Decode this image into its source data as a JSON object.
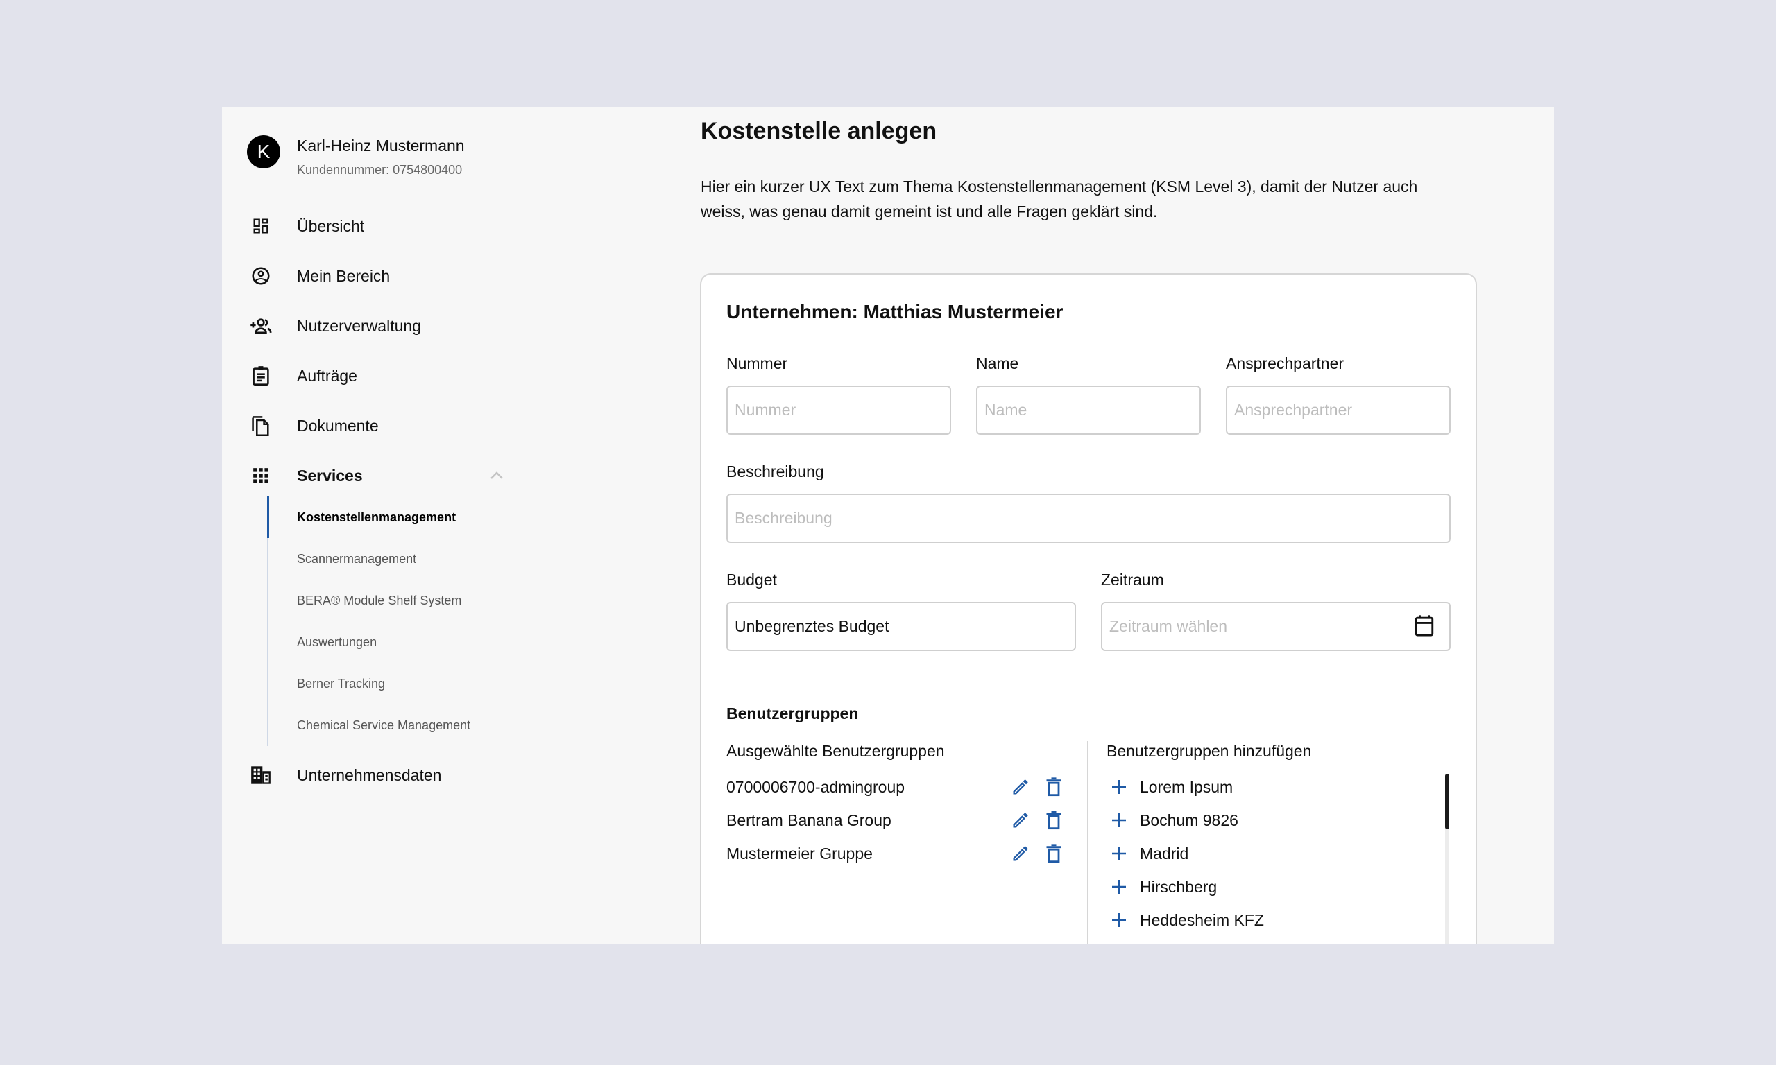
{
  "user": {
    "avatar_initial": "K",
    "name": "Karl-Heinz Mustermann",
    "customer_number": "Kundennummer: 0754800400"
  },
  "sidebar": {
    "items": [
      {
        "label": "Übersicht",
        "icon": "dashboard-icon"
      },
      {
        "label": "Mein Bereich",
        "icon": "account-circle-icon"
      },
      {
        "label": "Nutzerverwaltung",
        "icon": "group-add-icon"
      },
      {
        "label": "Aufträge",
        "icon": "clipboard-icon"
      },
      {
        "label": "Dokumente",
        "icon": "copy-documents-icon"
      },
      {
        "label": "Services",
        "icon": "apps-grid-icon",
        "expanded": true
      }
    ],
    "services_sub": [
      {
        "label": "Kostenstellenmanagement",
        "active": true
      },
      {
        "label": "Scannermanagement"
      },
      {
        "label": "BERA® Module Shelf System"
      },
      {
        "label": "Auswertungen"
      },
      {
        "label": "Berner Tracking"
      },
      {
        "label": "Chemical Service Management"
      }
    ],
    "bottom_item": {
      "label": "Unternehmensdaten",
      "icon": "business-building-icon"
    }
  },
  "main": {
    "title": "Kostenstelle anlegen",
    "description": "Hier ein kurzer UX Text zum Thema Kostenstellenmanagement (KSM Level 3), damit der Nutzer auch weiss, was genau damit gemeint ist und alle Fragen geklärt sind.",
    "card": {
      "title": "Unternehmen: Matthias Mustermeier",
      "fields": {
        "nummer": {
          "label": "Nummer",
          "placeholder": "Nummer",
          "value": ""
        },
        "name": {
          "label": "Name",
          "placeholder": "Name",
          "value": ""
        },
        "ansprechpartner": {
          "label": "Ansprechpartner",
          "placeholder": "Ansprechpartner",
          "value": ""
        },
        "beschreibung": {
          "label": "Beschreibung",
          "placeholder": "Beschreibung",
          "value": ""
        },
        "budget": {
          "label": "Budget",
          "value": "Unbegrenztes Budget"
        },
        "zeitraum": {
          "label": "Zeitraum",
          "placeholder": "Zeitraum wählen",
          "value": ""
        }
      },
      "groups": {
        "title": "Benutzergruppen",
        "selected_title": "Ausgewählte Benutzergruppen",
        "selected": [
          "0700006700-admingroup",
          "Bertram Banana Group",
          "Mustermeier Gruppe"
        ],
        "add_title": "Benutzergruppen hinzufügen",
        "available": [
          "Lorem Ipsum",
          "Bochum 9826",
          "Madrid",
          "Hirschberg",
          "Heddesheim KFZ"
        ]
      }
    }
  },
  "colors": {
    "accent": "#1f5aa6",
    "background": "#e2e3ec",
    "panel": "#f7f7f7",
    "card": "#ffffff"
  }
}
